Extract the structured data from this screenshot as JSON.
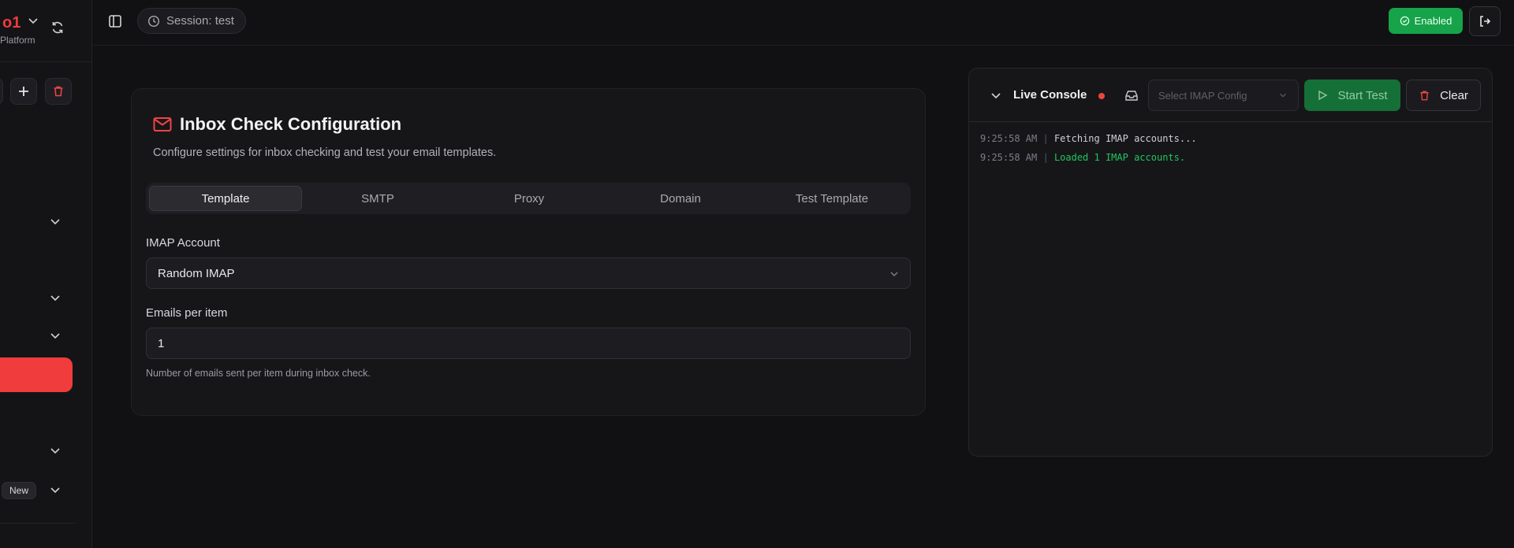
{
  "sidebar": {
    "brand_name": "o1",
    "brand_sub": "Platform",
    "new_badge": "New"
  },
  "topbar": {
    "session_label": "Session: test",
    "enabled_label": "Enabled"
  },
  "config": {
    "title": "Inbox Check Configuration",
    "description": "Configure settings for inbox checking and test your email templates.",
    "tabs": [
      "Template",
      "SMTP",
      "Proxy",
      "Domain",
      "Test Template"
    ],
    "active_tab": "Template",
    "imap_label": "IMAP Account",
    "imap_value": "Random IMAP",
    "emails_label": "Emails per item",
    "emails_value": "1",
    "emails_help": "Number of emails sent per item during inbox check."
  },
  "console": {
    "title": "Live Console",
    "select_placeholder": "Select IMAP Config",
    "start_label": "Start Test",
    "clear_label": "Clear",
    "logs": [
      {
        "time": "9:25:58 AM",
        "message": "Fetching IMAP accounts...",
        "status": "info"
      },
      {
        "time": "9:25:58 AM",
        "message": "Loaded 1 IMAP accounts.",
        "status": "success"
      }
    ]
  },
  "colors": {
    "accent_red": "#ef3b3b",
    "success_green": "#16a34a",
    "background": "#111113"
  }
}
